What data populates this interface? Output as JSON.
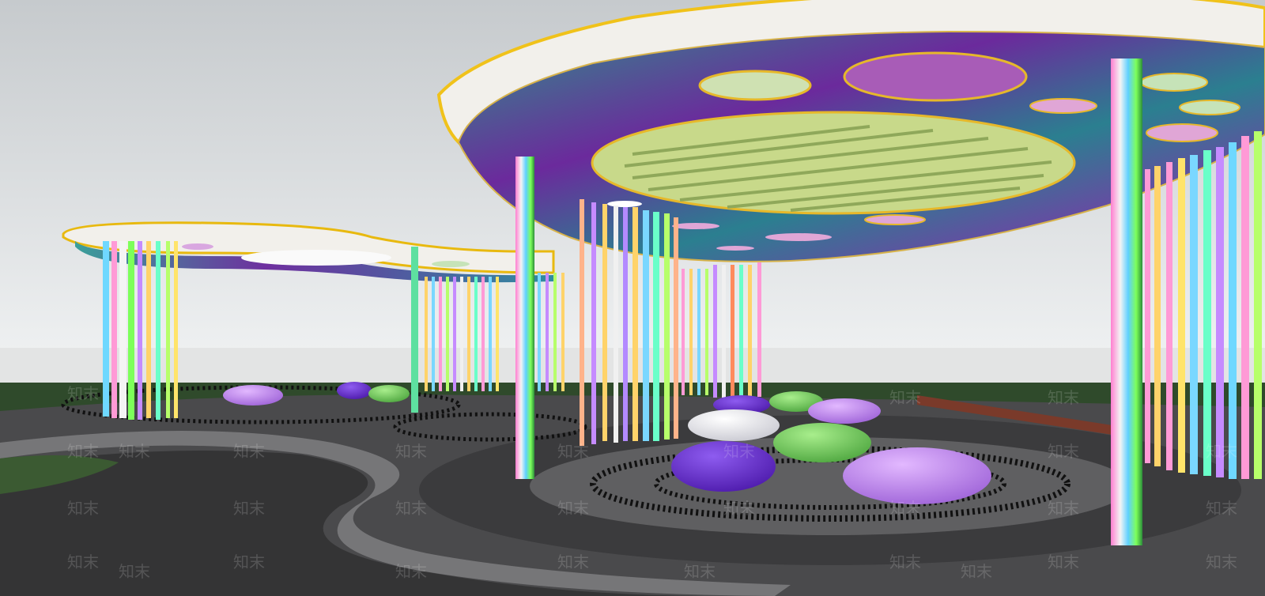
{
  "scene": {
    "description_visible": false,
    "watermark_text": "知末",
    "colors": {
      "sky_top": "#c9cdd0",
      "sky_bottom": "#eceeef",
      "grass": "#2f4a2b",
      "paving_dark": "#3a3a3b",
      "paving_light": "#6e6e70",
      "canopy_rim": "#f4f2ee",
      "canopy_gold": "#f0c21a",
      "canopy_teal": "#2f8f8a",
      "canopy_purple": "#6b2a9c",
      "slat_green": "#c8d98a"
    },
    "pillar_colors": [
      "#ff9ad6",
      "#7ad7ff",
      "#b7ff6a",
      "#ffd36a",
      "#c58bff",
      "#6affc9",
      "#ff8a5c",
      "#f0f0f0"
    ],
    "stool_colors": [
      "#b77be6",
      "#6a2ad1",
      "#5fc04a",
      "#e6e6ea"
    ]
  }
}
